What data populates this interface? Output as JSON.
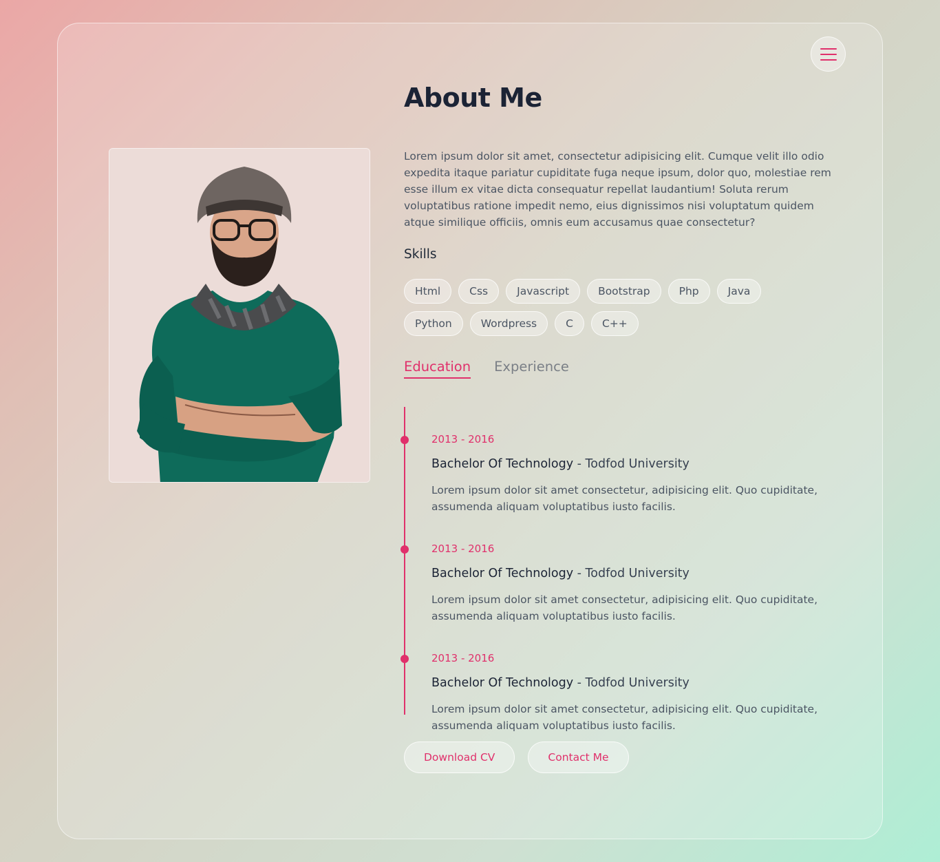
{
  "page": {
    "title": "About Me",
    "intro": "Lorem ipsum dolor sit amet, consectetur adipisicing elit. Cumque velit illo odio expedita itaque pariatur cupiditate fuga neque ipsum, dolor quo, molestiae rem esse illum ex vitae dicta consequatur repellat laudantium! Soluta rerum voluptatibus ratione impedit nemo, eius dignissimos nisi voluptatum quidem atque similique officiis, omnis eum accusamus quae consectetur?"
  },
  "skills": {
    "title": "Skills",
    "items": [
      "Html",
      "Css",
      "Javascript",
      "Bootstrap",
      "Php",
      "Java",
      "Python",
      "Wordpress",
      "C",
      "C++"
    ]
  },
  "tabs": [
    {
      "label": "Education",
      "active": true
    },
    {
      "label": "Experience",
      "active": false
    }
  ],
  "timeline": [
    {
      "date": "2013 - 2016",
      "degree": "Bachelor Of Technology",
      "separator": "-",
      "school": "Todfod University",
      "text": "Lorem ipsum dolor sit amet consectetur, adipisicing elit. Quo cupiditate, assumenda aliquam voluptatibus iusto facilis."
    },
    {
      "date": "2013 - 2016",
      "degree": "Bachelor Of Technology",
      "separator": "-",
      "school": "Todfod University",
      "text": "Lorem ipsum dolor sit amet consectetur, adipisicing elit. Quo cupiditate, assumenda aliquam voluptatibus iusto facilis."
    },
    {
      "date": "2013 - 2016",
      "degree": "Bachelor Of Technology",
      "separator": "-",
      "school": "Todfod University",
      "text": "Lorem ipsum dolor sit amet consectetur, adipisicing elit. Quo cupiditate, assumenda aliquam voluptatibus iusto facilis."
    }
  ],
  "actions": {
    "download_label": "Download CV",
    "contact_label": "Contact Me"
  },
  "icons": {
    "menu": "hamburger-menu-icon"
  },
  "colors": {
    "accent": "#e0306b",
    "heading": "#1b2335",
    "body_text": "#4b5563"
  }
}
